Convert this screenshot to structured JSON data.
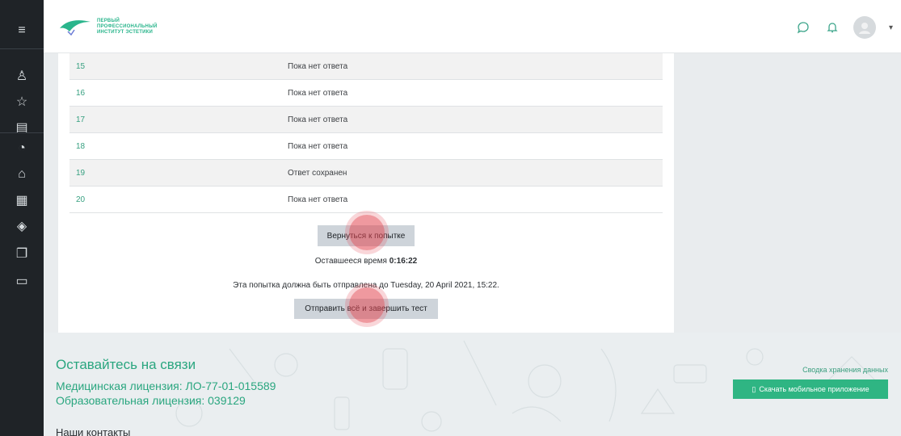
{
  "sidebar": {
    "items": [
      {
        "icon": "menu-icon",
        "glyph": "≡"
      },
      {
        "icon": "badges-icon",
        "glyph": "♙"
      },
      {
        "icon": "star-icon",
        "glyph": "☆"
      },
      {
        "icon": "book-icon",
        "glyph": "▤"
      },
      {
        "icon": "dashboard-icon",
        "glyph": "◔"
      },
      {
        "icon": "home-icon",
        "glyph": "⌂"
      },
      {
        "icon": "calendar-icon",
        "glyph": "▦"
      },
      {
        "icon": "graduation-cap-icon",
        "glyph": "◈"
      },
      {
        "icon": "files-icon",
        "glyph": "❐"
      },
      {
        "icon": "folder-icon",
        "glyph": "▭"
      }
    ]
  },
  "header": {
    "logo_lines": [
      "ПЕРВЫЙ",
      "ПРОФЕССИОНАЛЬНЫЙ",
      "ИНСТИТУТ ЭСТЕТИКИ"
    ],
    "accent_color": "#2ab58c"
  },
  "quiz": {
    "rows": [
      {
        "number": "15",
        "status": "Пока нет ответа"
      },
      {
        "number": "16",
        "status": "Пока нет ответа"
      },
      {
        "number": "17",
        "status": "Пока нет ответа"
      },
      {
        "number": "18",
        "status": "Пока нет ответа"
      },
      {
        "number": "19",
        "status": "Ответ сохранен"
      },
      {
        "number": "20",
        "status": "Пока нет ответа"
      }
    ],
    "return_button": "Вернуться к попытке",
    "time_label": "Оставшееся время",
    "time_value": "0:16:22",
    "deadline_text": "Эта попытка должна быть отправлена до Tuesday, 20 April 2021, 15:22.",
    "submit_button": "Отправить всё и завершить тест"
  },
  "footer": {
    "title": "Оставайтесь на связи",
    "medical_license": "Медицинская лицензия: ЛО-77-01-015589",
    "edu_license": "Образовательная лицензия: 039129",
    "contacts": "Наши контакты",
    "data_summary": "Сводка хранения данных",
    "app_button": "Скачать мобильное приложение"
  }
}
